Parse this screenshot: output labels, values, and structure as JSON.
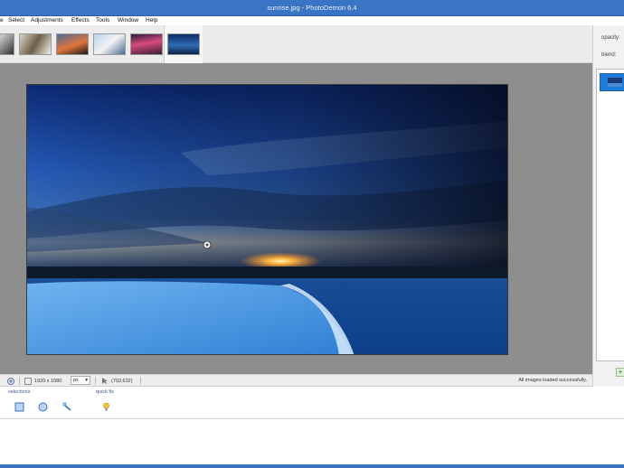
{
  "window": {
    "title": "sunrise.jpg  -  PhotoDemon 6.4"
  },
  "menu": {
    "items": [
      "File",
      "Select",
      "Adjustments",
      "Effects",
      "Tools",
      "Window",
      "Help"
    ],
    "visible_first_fragment": "e"
  },
  "thumbnails": {
    "count": 6,
    "active_index": 5
  },
  "right_panel": {
    "opacity_label": "opacity:",
    "blend_label": "blend:"
  },
  "status_bar": {
    "image_size": "1920 x 1080",
    "unit": "px",
    "unit_icon": "chevron-down-icon",
    "coords": "(702,632)",
    "message": "All images loaded successfully."
  },
  "tool_options": {
    "selections_label": "selections",
    "quick_fix_label": "quick fix"
  },
  "colors": {
    "titlebar": "#3a74c4",
    "canvas_bg": "#8e8e8e",
    "accent": "#1f7ad8"
  }
}
